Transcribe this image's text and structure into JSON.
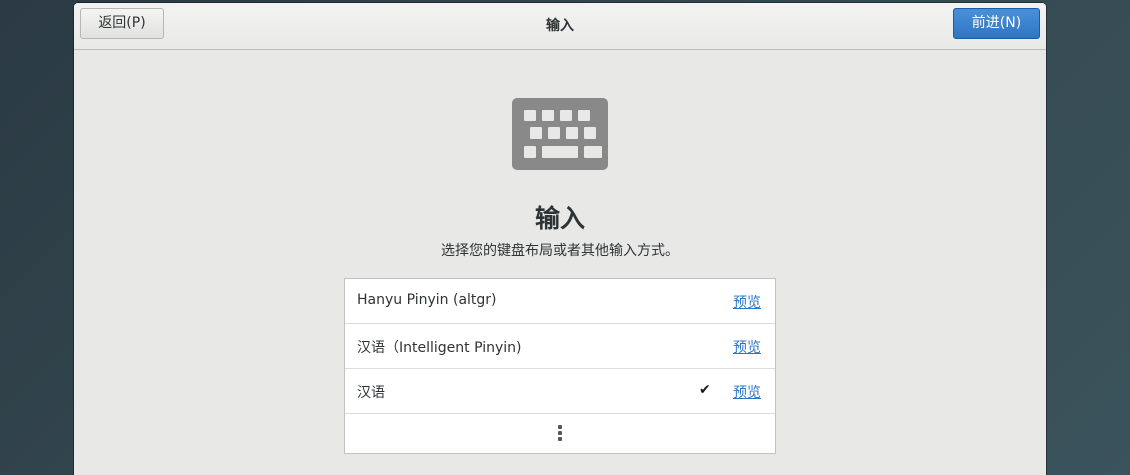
{
  "header": {
    "back_label": "返回(P)",
    "title": "输入",
    "next_label": "前进(N)"
  },
  "main": {
    "icon": "keyboard-icon",
    "title": "输入",
    "subtitle": "选择您的键盘布局或者其他输入方式。"
  },
  "input_sources": [
    {
      "label": "Hanyu Pinyin (altgr)",
      "selected": false,
      "preview_label": "预览"
    },
    {
      "label": "汉语（Intelligent Pinyin)",
      "selected": false,
      "preview_label": "预览"
    },
    {
      "label": "汉语",
      "selected": true,
      "check_glyph": "✔",
      "preview_label": "预览"
    }
  ],
  "more_icon": "view-more-icon",
  "colors": {
    "accent": "#2f75c2",
    "link": "#2a76c6",
    "window_bg": "#e8e8e7",
    "icon_gray": "#898989"
  }
}
